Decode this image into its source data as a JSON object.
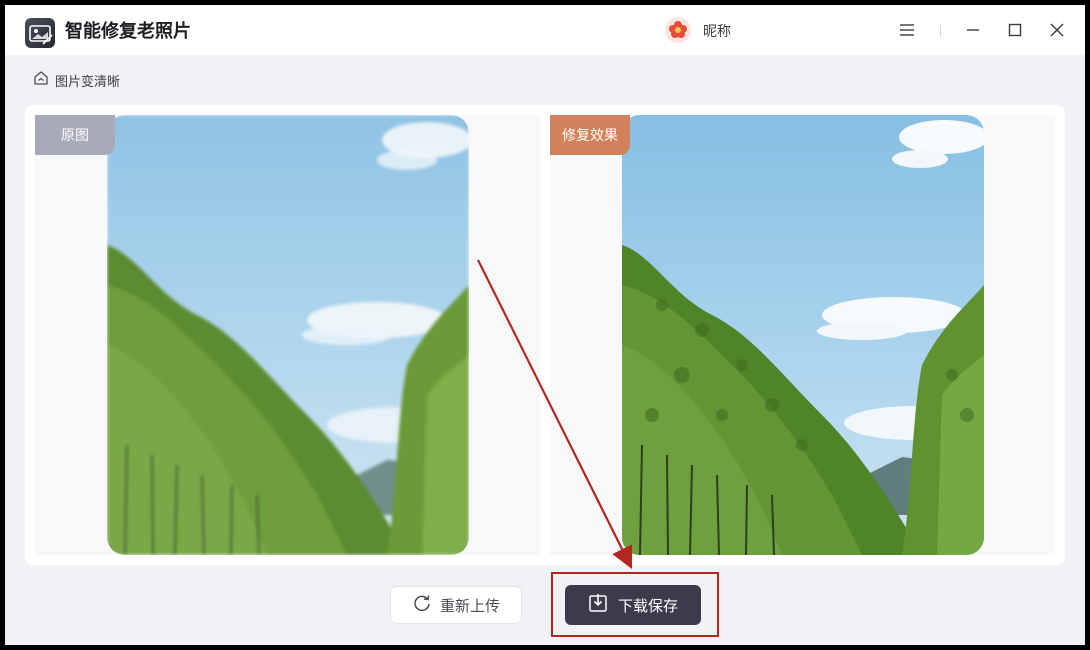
{
  "app": {
    "title": "智能修复老照片",
    "logo_icon": "magic-wand-photo-icon"
  },
  "user": {
    "name": "昵称",
    "avatar_icon": "flower-avatar-icon"
  },
  "window_controls": {
    "menu_icon": "hamburger-menu-icon",
    "minimize_icon": "minimize-icon",
    "maximize_icon": "maximize-icon",
    "close_icon": "close-icon"
  },
  "breadcrumb": {
    "icon": "home-icon",
    "label": "图片变清晰"
  },
  "compare": {
    "original_label": "原图",
    "result_label": "修复效果",
    "original_label_color": "#a9aab9",
    "result_label_color": "#d1825a"
  },
  "actions": {
    "reupload_label": "重新上传",
    "reupload_icon": "refresh-icon",
    "download_label": "下载保存",
    "download_icon": "download-icon"
  },
  "colors": {
    "primary_button": "#3d3a4b",
    "annotation": "#b3261e"
  }
}
